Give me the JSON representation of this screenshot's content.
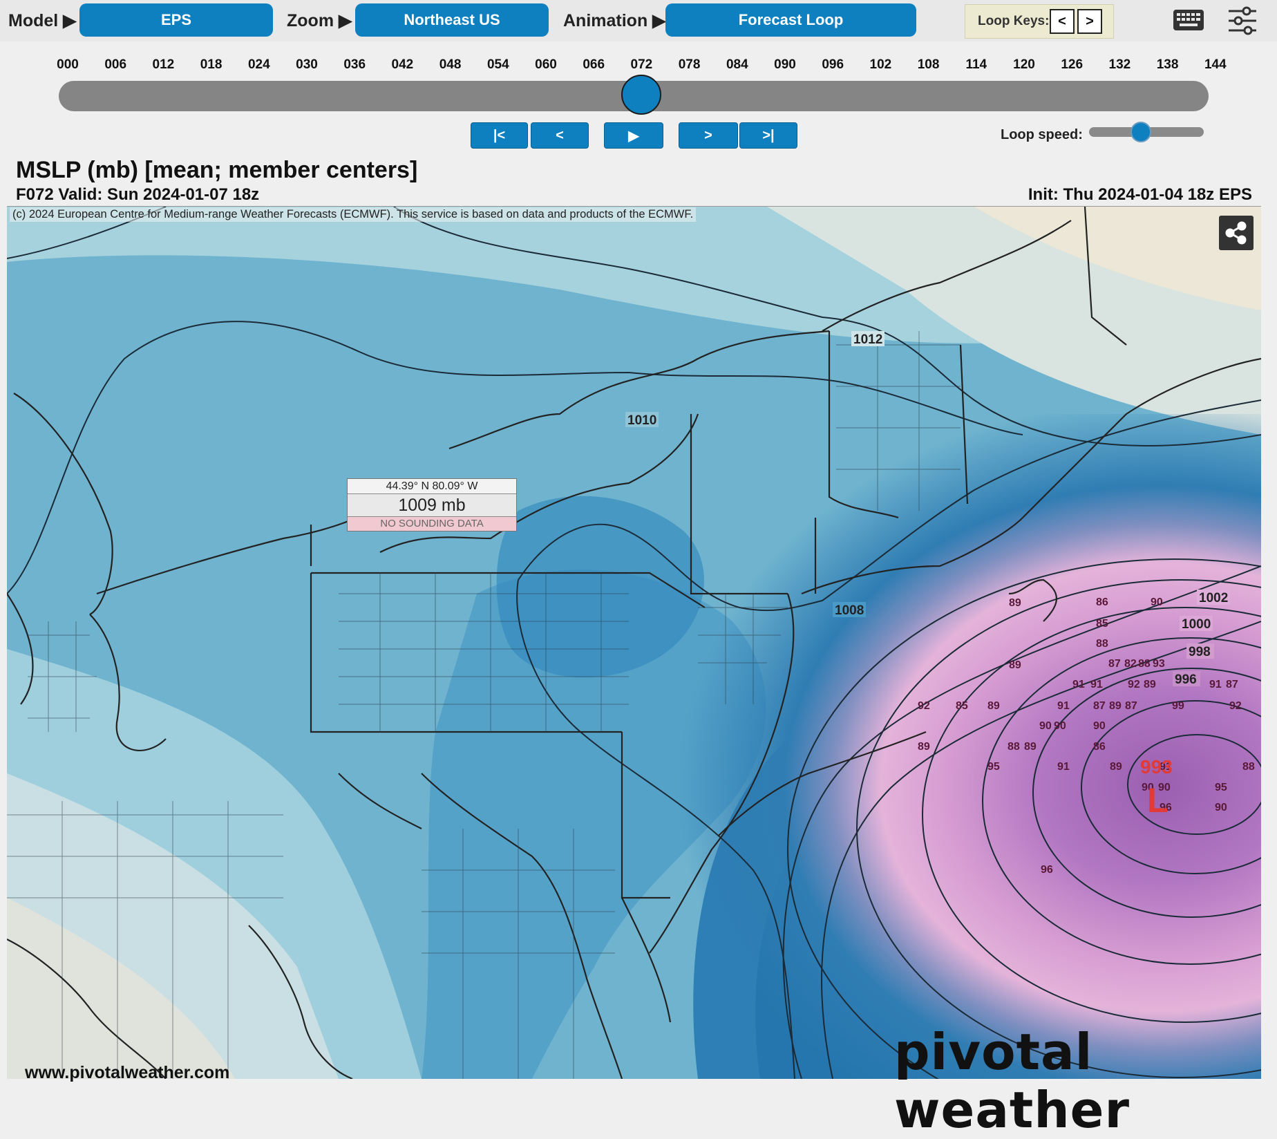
{
  "toolbar": {
    "model_label": "Model ▶",
    "model_value": "EPS",
    "zoom_label": "Zoom ▶",
    "zoom_value": "Northeast US",
    "animation_label": "Animation ▶",
    "animation_value": "Forecast Loop",
    "loop_keys_label": "Loop Keys:",
    "loop_key_prev": "<",
    "loop_key_next": ">",
    "keyboard_icon": "keyboard-icon",
    "settings_icon": "sliders-icon"
  },
  "timeline": {
    "hours": [
      "000",
      "006",
      "012",
      "018",
      "024",
      "030",
      "036",
      "042",
      "048",
      "054",
      "060",
      "066",
      "072",
      "078",
      "084",
      "090",
      "096",
      "102",
      "108",
      "114",
      "120",
      "126",
      "132",
      "138",
      "144"
    ],
    "selected_hour": "072",
    "selected_index": 12
  },
  "playback": {
    "first": "|<",
    "prev": "<",
    "play": "▶",
    "next": ">",
    "last": ">|",
    "speed_label": "Loop speed:",
    "speed_level": 0.45
  },
  "product": {
    "title": "MSLP (mb) [mean; member centers]",
    "valid": "F072 Valid: Sun 2024-01-07 18z",
    "init": "Init: Thu 2024-01-04 18z EPS",
    "copyright": "(c) 2024 European Centre for Medium-range Weather Forecasts (ECMWF). This service is based on data and products of the ECMWF."
  },
  "popup": {
    "coords": "44.39° N 80.09° W",
    "value": "1009 mb",
    "note": "NO SOUNDING DATA"
  },
  "map": {
    "isobar_labels": [
      "1012",
      "1010",
      "1008",
      "1002",
      "1000",
      "998",
      "996"
    ],
    "low_center_value": "993",
    "low_symbol": "L",
    "member_labels": [
      "89",
      "86",
      "90",
      "85",
      "88",
      "89",
      "87",
      "82",
      "88",
      "93",
      "91",
      "91",
      "92",
      "89",
      "91",
      "87",
      "92",
      "85",
      "89",
      "92",
      "91",
      "87",
      "89",
      "87",
      "99",
      "90",
      "90",
      "90",
      "88",
      "89",
      "86",
      "89",
      "95",
      "91",
      "89",
      "91",
      "88",
      "90",
      "90",
      "95",
      "96",
      "90",
      "96"
    ],
    "watermark": "pivotal weather",
    "site_url": "www.pivotalweather.com",
    "colors": {
      "low_label": "#e23a36",
      "high_pressure_bg": "#d8e6e8",
      "low_pressure_bg": "#9a5aa8"
    }
  }
}
